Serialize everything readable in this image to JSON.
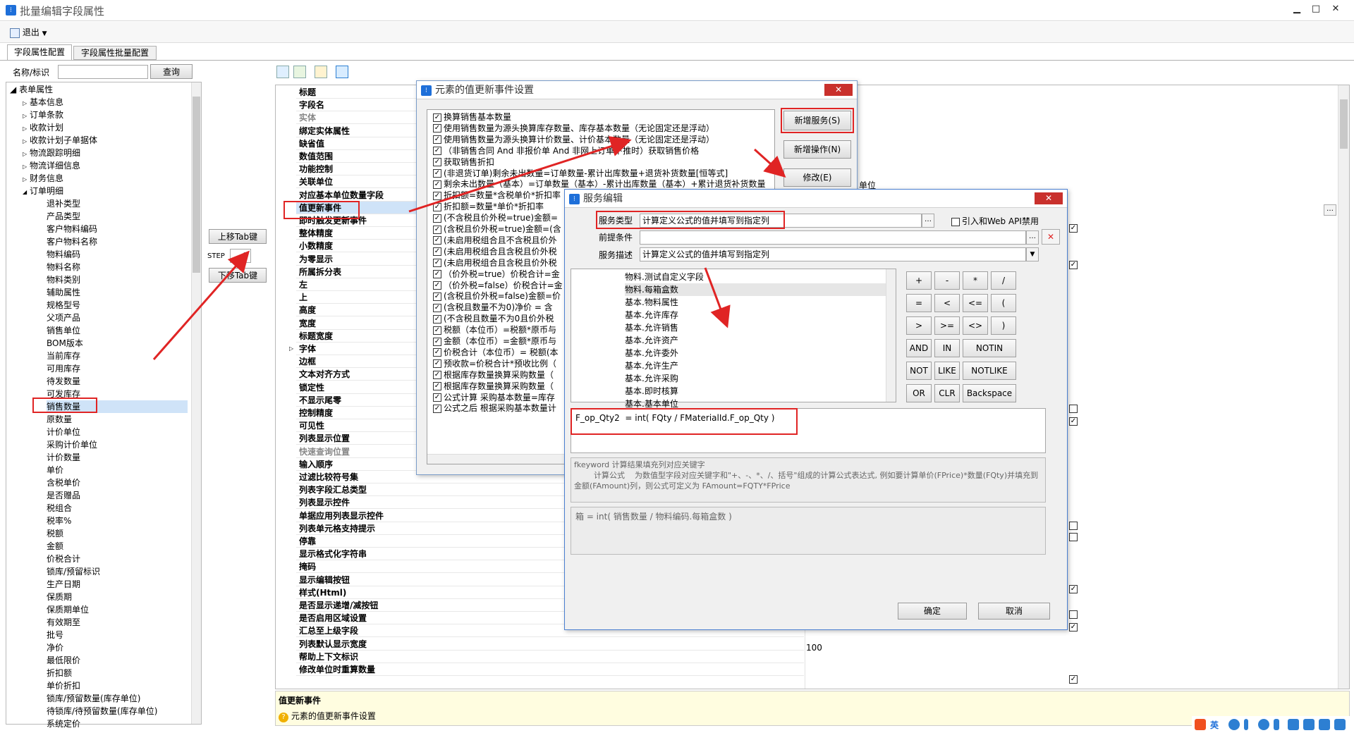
{
  "window": {
    "title": "批量编辑字段属性",
    "icon": "app-icon",
    "minimize": "▁",
    "maximize": "□",
    "close": "✕"
  },
  "toolbar": {
    "exit_label": "退出"
  },
  "tabs": [
    "字段属性配置",
    "字段属性批量配置"
  ],
  "search": {
    "label": "名称/标识",
    "value": "",
    "button": "查询"
  },
  "tree": {
    "root": "表单属性",
    "groups": [
      "基本信息",
      "订单条款",
      "收款计划",
      "收款计划子单据体",
      "物流跟踪明细",
      "物流详细信息",
      "财务信息",
      "订单明细"
    ],
    "items": [
      "退补类型",
      "产品类型",
      "客户物料编码",
      "客户物料名称",
      "物料编码",
      "物料名称",
      "物料类别",
      "辅助属性",
      "规格型号",
      "父项产品",
      "销售单位",
      "BOM版本",
      "当前库存",
      "可用库存",
      "待发数量",
      "可发库存",
      "销售数量",
      "原数量",
      "计价单位",
      "采购计价单位",
      "计价数量",
      "单价",
      "含税单价",
      "是否赠品",
      "税组合",
      "税率%",
      "税额",
      "金额",
      "价税合计",
      "锁库/预留标识",
      "生产日期",
      "保质期",
      "保质期单位",
      "有效期至",
      "批号",
      "净价",
      "最低限价",
      "折扣额",
      "单价折扣",
      "锁库/预留数量(库存单位)",
      "待锁库/待预留数量(库存单位)",
      "系统定价"
    ]
  },
  "tab_move": {
    "up": "上移Tab键",
    "step_label": "STEP",
    "step_value": "1",
    "down": "下移Tab键"
  },
  "props": [
    "标题",
    "字段名",
    "实体",
    "绑定实体属性",
    "缺省值",
    "数值范围",
    "功能控制",
    "关联单位",
    "对应基本单位数量字段",
    "值更新事件",
    "即时触发更新事件",
    "整体精度",
    "小数精度",
    "为零显示",
    "所属拆分表",
    "左",
    "上",
    "高度",
    "宽度",
    "标题宽度",
    "字体",
    "边框",
    "文本对齐方式",
    "锁定性",
    "不显示尾零",
    "控制精度",
    "可见性",
    "列表显示位置",
    "快速查询位置",
    "输入顺序",
    "过滤比较符号集",
    "列表字段汇总类型",
    "列表显示控件",
    "单据应用列表显示控件",
    "列表单元格支持提示",
    "停靠",
    "显示格式化字符串",
    "掩码",
    "显示编辑按钮",
    "样式(Html)",
    "是否显示递增/减按钮",
    "是否启用区域设置",
    "汇总至上级字段",
    "列表默认显示宽度",
    "帮助上下文标识",
    "修改单位时重算数量"
  ],
  "prop_values": {
    "unit_text": "单位",
    "list_width": "100",
    "checked_mark": "✓"
  },
  "bottom_info": {
    "title": "值更新事件",
    "desc": "元素的值更新事件设置"
  },
  "dialog1": {
    "title": "元素的值更新事件设置",
    "close": "✕",
    "buttons": [
      "新增服务(S)",
      "新增操作(N)",
      "修改(E)"
    ],
    "scroll_label": "III",
    "events": [
      "换算销售基本数量",
      "使用销售数量为源头换算库存数量、库存基本数量（无论固定还是浮动）",
      "使用销售数量为源头换算计价数量、计价基本数量（无论固定还是浮动）",
      "（非销售合同 And 非报价单 And 非网上订单下推时）获取销售价格",
      "获取销售折扣",
      "(非退货订单)剩余未出数量=订单数量-累计出库数量+退货补货数量[恒等式]",
      "剩余未出数量（基本）=订单数量（基本）-累计出库数量（基本）+累计退货补货数量",
      "折扣额=数量*含税单价*折扣率",
      "折扣额=数量*单价*折扣率",
      "(不含税且价外税=true)金额=",
      "(含税且价外税=true)金额=(含",
      "(未启用税组合且不含税且价外",
      "(未启用税组合且含税且价外税",
      "(未启用税组合且含税且价外税",
      "（价外税=true）价税合计=金",
      "（价外税=false）价税合计=金",
      "(含税且价外税=false)金额=价",
      "(含税且数量不为0)净价 = 含",
      "(不含税且数量不为0且价外税",
      "税额（本位币）=税额*原币与",
      "金额（本位币）=金额*原币与",
      "价税合计（本位币）= 税额(本",
      "预收款=价税合计*预收比例（",
      "根据库存数量换算采购数量（",
      "根据库存数量换算采购数量（",
      "公式计算 采购基本数量=库存",
      "公式之后 根据采购基本数量计"
    ]
  },
  "dialog2": {
    "title": "服务编辑",
    "close": "✕",
    "service_type_label": "服务类型",
    "service_type_value": "计算定义公式的值并填写到指定列",
    "precondition_label": "前提条件",
    "precondition_value": "",
    "service_desc_label": "服务描述",
    "service_desc_value": "计算定义公式的值并填写到指定列",
    "web_api_label": "引入和Web API禁用",
    "fields_list": [
      "物料.测试自定义字段",
      "物料.每箱盒数",
      "基本.物料属性",
      "基本.允许库存",
      "基本.允许销售",
      "基本.允许资产",
      "基本.允许委外",
      "基本.允许生产",
      "基本.允许采购",
      "基本.即时核算",
      "基本.基本单位"
    ],
    "operators": [
      "+",
      "-",
      "*",
      "/",
      "=",
      "<",
      "<=",
      "(",
      ">",
      ">=",
      "<>",
      ")",
      "AND",
      "IN",
      "NOTIN",
      "NOT",
      "LIKE",
      "NOTLIKE",
      "OR",
      "CLR",
      "Backspace"
    ],
    "formula": "F_op_Qty2  = int( FQty / FMaterialId.F_op_Qty )",
    "help_text_1": "fkeyword  计算结果填充列对应关键字",
    "help_text_2": "        计算公式    为数值型字段对应关键字和\"+、-、*、/、括号\"组成的计算公式表达式, 例如要计算单价(FPrice)*数量(FQty)并填充到金额(FAmount)列，则公式可定义为 FAmount=FQTY*FPrice",
    "display_formula": "箱  = int( 销售数量 / 物料编码.每箱盒数 )",
    "ok": "确定",
    "cancel": "取消"
  },
  "taskbar": {
    "ime": "英",
    "icons": [
      "sogou-icon",
      "moon-icon",
      "comma-icon",
      "emoji-icon",
      "mic-icon",
      "keyboard-icon",
      "person-icon",
      "shirt-icon",
      "grid-icon"
    ]
  },
  "colors": {
    "highlight_red": "#e02424",
    "arrow_red": "#e02424",
    "title_blue": "#1e6fd9",
    "selected_bg": "#cfe3f8",
    "help_yellow": "#fffde0"
  }
}
